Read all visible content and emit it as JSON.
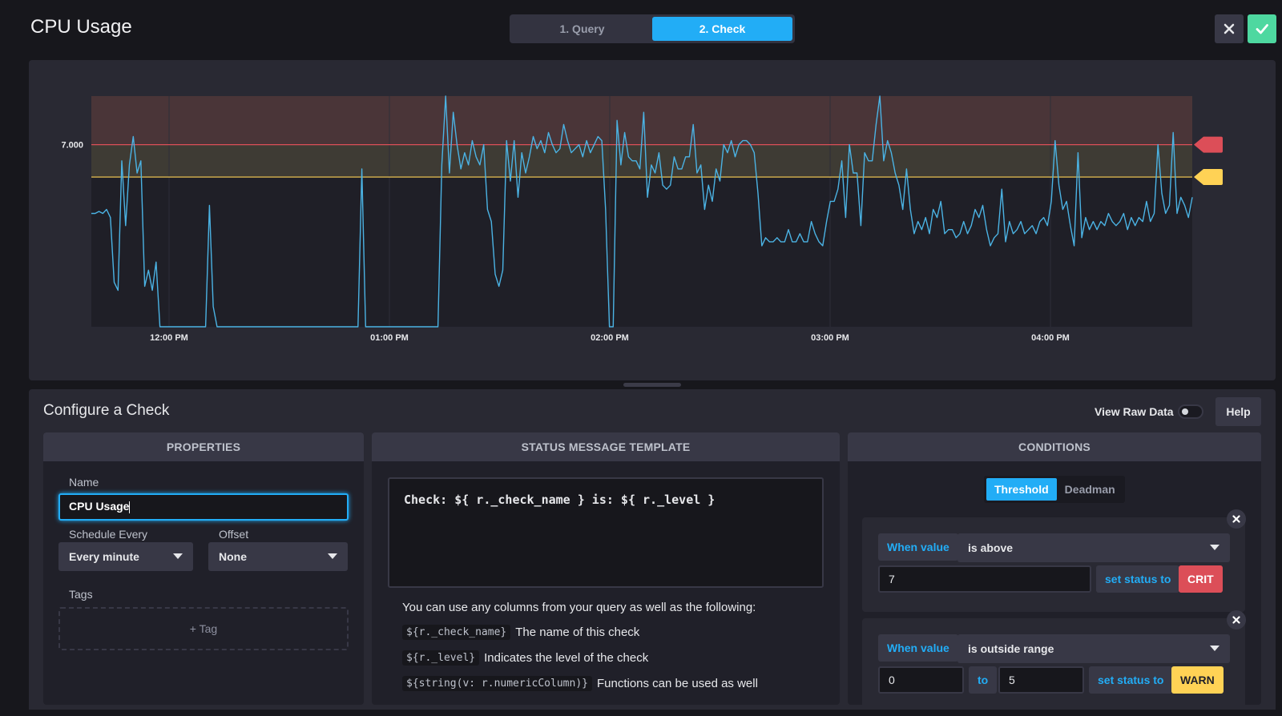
{
  "header": {
    "title": "CPU Usage",
    "steps": [
      {
        "label": "1. Query",
        "active": false
      },
      {
        "label": "2. Check",
        "active": true
      }
    ],
    "close_icon": "close-icon",
    "confirm_icon": "checkmark-icon"
  },
  "chart_data": {
    "type": "line",
    "y_tick_labels": [
      "7.000"
    ],
    "x_tick_labels": [
      "12:00 PM",
      "01:00 PM",
      "02:00 PM",
      "03:00 PM",
      "04:00 PM"
    ],
    "series": [
      {
        "color": "#4bb3e4",
        "values": [
          5.3,
          5.3,
          5.35,
          5.3,
          5.4,
          5.2,
          3.6,
          3.4,
          6.6,
          5.0,
          6.5,
          7.2,
          6.3,
          6.6,
          3.5,
          3.9,
          3.4,
          4.1,
          2.5,
          2.5,
          2.5,
          2.5,
          2.5,
          2.5,
          2.5,
          2.5,
          2.5,
          2.5,
          2.5,
          2.5,
          2.5,
          5.5,
          3.0,
          2.5,
          2.5,
          2.5,
          2.5,
          2.5,
          2.5,
          2.5,
          2.5,
          2.5,
          2.5,
          2.5,
          2.5,
          2.5,
          2.5,
          2.5,
          2.5,
          2.5,
          2.5,
          2.5,
          2.5,
          2.5,
          2.5,
          2.5,
          2.5,
          2.5,
          2.5,
          2.5,
          2.5,
          2.5,
          2.5,
          2.5,
          2.5,
          2.5,
          2.5,
          2.5,
          2.5,
          2.5,
          2.5,
          6.4,
          2.5,
          2.5,
          2.5,
          2.5,
          2.5,
          2.5,
          2.5,
          2.5,
          2.5,
          2.5,
          2.5,
          2.5,
          2.5,
          2.5,
          2.5,
          2.5,
          2.5,
          2.5,
          2.5,
          2.5,
          6.5,
          8.2,
          6.3,
          7.8,
          7.0,
          6.4,
          6.8,
          6.5,
          7.1,
          6.7,
          6.5,
          7.0,
          5.4,
          5.1,
          3.8,
          3.5,
          3.9,
          7.1,
          6.1,
          7.1,
          5.7,
          6.8,
          6.3,
          6.7,
          7.2,
          6.9,
          7.1,
          6.8,
          7.3,
          7.0,
          6.8,
          6.9,
          7.5,
          7.1,
          6.8,
          6.9,
          7.0,
          6.7,
          7.1,
          6.8,
          7.0,
          7.2,
          7.1,
          5.4,
          2.5,
          2.5,
          7.6,
          6.5,
          7.3,
          6.7,
          6.6,
          6.6,
          6.4,
          7.8,
          5.7,
          6.5,
          6.3,
          6.8,
          6.0,
          5.9,
          6.0,
          6.7,
          6.4,
          6.4,
          6.7,
          6.7,
          7.5,
          6.3,
          6.5,
          5.4,
          6.0,
          5.6,
          6.4,
          6.1,
          7.0,
          6.8,
          7.1,
          6.7,
          7.0,
          7.1,
          7.1,
          7.0,
          6.8,
          5.8,
          4.5,
          4.7,
          4.6,
          4.6,
          4.7,
          4.6,
          4.6,
          4.9,
          4.6,
          4.6,
          4.8,
          4.6,
          4.6,
          5.1,
          4.8,
          4.6,
          4.5,
          5.1,
          5.6,
          5.6,
          5.9,
          6.6,
          5.2,
          7.0,
          6.3,
          6.3,
          5.0,
          6.8,
          6.6,
          6.6,
          7.5,
          8.2,
          6.6,
          7.1,
          6.8,
          6.3,
          6.0,
          5.4,
          6.4,
          5.4,
          4.8,
          5.1,
          4.9,
          5.2,
          4.8,
          5.4,
          5.2,
          5.6,
          4.8,
          4.9,
          4.9,
          4.7,
          4.8,
          5.1,
          4.8,
          5.0,
          5.4,
          5.2,
          5.5,
          4.9,
          4.5,
          4.7,
          4.8,
          5.9,
          4.6,
          5.1,
          4.8,
          4.9,
          5.1,
          4.8,
          4.9,
          5.0,
          4.8,
          5.1,
          5.2,
          5.0,
          5.6,
          7.1,
          6.0,
          5.4,
          5.6,
          5.0,
          4.5,
          6.8,
          4.7,
          5.2,
          4.9,
          5.1,
          4.9,
          5.1,
          5.0,
          5.3,
          5.1,
          5.0,
          5.1,
          5.3,
          4.9,
          5.2,
          5.0,
          5.2,
          5.1,
          5.6,
          5.1,
          5.3,
          7.0,
          5.8,
          5.3,
          5.5,
          7.3,
          5.3,
          5.7,
          5.5,
          5.2,
          5.7
        ]
      }
    ],
    "thresholds": [
      {
        "level": "CRIT",
        "condition": "is above",
        "value": 7,
        "color": "#dc4e58"
      },
      {
        "level": "WARN",
        "condition": "is outside range",
        "range": [
          0,
          5
        ],
        "color": "#ffd255"
      }
    ],
    "grid": true
  },
  "configure": {
    "title": "Configure a Check",
    "view_raw_label": "View Raw Data",
    "view_raw_on": false,
    "help_label": "Help"
  },
  "properties": {
    "heading": "PROPERTIES",
    "name_label": "Name",
    "name_value": "CPU Usage",
    "schedule_label": "Schedule Every",
    "schedule_value": "Every minute",
    "offset_label": "Offset",
    "offset_value": "None",
    "tags_label": "Tags",
    "add_tag_label": "+ Tag"
  },
  "status_template": {
    "heading": "STATUS MESSAGE TEMPLATE",
    "template": "Check: ${ r._check_name } is: ${ r._level }",
    "help_text": "You can use any columns from your query as well as the following:",
    "vars": [
      {
        "code": "${r._check_name}",
        "desc": "The name of this check"
      },
      {
        "code": "${r._level}",
        "desc": "Indicates the level of the check"
      },
      {
        "code": "${string(v: r.numericColumn)}",
        "desc": "Functions can be used as well"
      }
    ]
  },
  "conditions": {
    "heading": "CONDITIONS",
    "tabs": [
      {
        "label": "Threshold",
        "active": true
      },
      {
        "label": "Deadman",
        "active": false
      }
    ],
    "crit": {
      "when_label": "When value",
      "operator": "is above",
      "value": "7",
      "set_label": "set status to",
      "level": "CRIT"
    },
    "warn": {
      "when_label": "When value",
      "operator": "is outside range",
      "min": "0",
      "to_label": "to",
      "max": "5",
      "set_label": "set status to",
      "level": "WARN"
    }
  }
}
